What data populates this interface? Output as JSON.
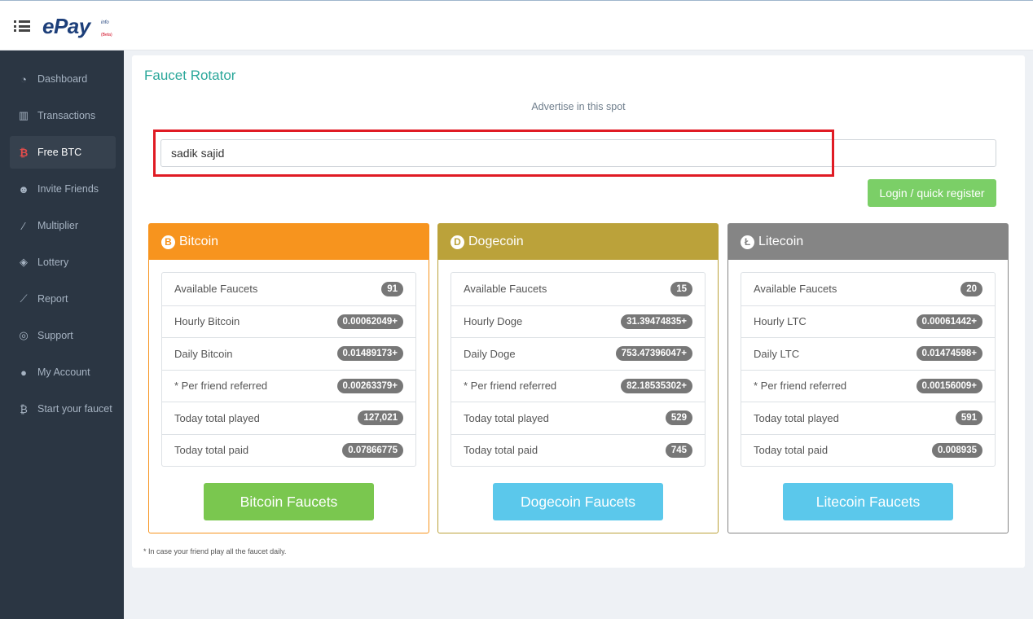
{
  "brand": {
    "logo": "ePay",
    "logo_sup": "info",
    "beta": "(Beta)"
  },
  "sidebar": {
    "items": [
      {
        "label": "Dashboard",
        "icon": "tachometer-icon"
      },
      {
        "label": "Transactions",
        "icon": "bar-chart-icon"
      },
      {
        "label": "Free BTC",
        "icon": "bitcoin-icon",
        "active": true
      },
      {
        "label": "Invite Friends",
        "icon": "users-icon"
      },
      {
        "label": "Multiplier",
        "icon": "magic-wand-icon"
      },
      {
        "label": "Lottery",
        "icon": "ticket-icon"
      },
      {
        "label": "Report",
        "icon": "line-chart-icon"
      },
      {
        "label": "Support",
        "icon": "life-ring-icon"
      },
      {
        "label": "My Account",
        "icon": "user-icon"
      },
      {
        "label": "Start your faucet",
        "icon": "bitcoin-icon"
      }
    ]
  },
  "main": {
    "title": "Faucet Rotator",
    "advertise": "Advertise in this spot",
    "address_value": "sadik sajid",
    "login_label": "Login / quick register",
    "note": "* In case your friend play all the faucet daily."
  },
  "coins": [
    {
      "name": "Bitcoin",
      "symbol": "B",
      "color": "#f7941e",
      "button_color": "#7ac74f",
      "button_label": "Bitcoin Faucets",
      "stats": [
        {
          "label": "Available Faucets",
          "value": "91"
        },
        {
          "label": "Hourly Bitcoin",
          "value": "0.00062049+"
        },
        {
          "label": "Daily Bitcoin",
          "value": "0.01489173+"
        },
        {
          "label": "* Per friend referred",
          "value": "0.00263379+"
        },
        {
          "label": "Today total played",
          "value": "127,021"
        },
        {
          "label": "Today total paid",
          "value": "0.07866775"
        }
      ]
    },
    {
      "name": "Dogecoin",
      "symbol": "D",
      "color": "#bba23a",
      "button_color": "#5bc8eb",
      "button_label": "Dogecoin Faucets",
      "stats": [
        {
          "label": "Available Faucets",
          "value": "15"
        },
        {
          "label": "Hourly Doge",
          "value": "31.39474835+"
        },
        {
          "label": "Daily Doge",
          "value": "753.47396047+"
        },
        {
          "label": "* Per friend referred",
          "value": "82.18535302+"
        },
        {
          "label": "Today total played",
          "value": "529"
        },
        {
          "label": "Today total paid",
          "value": "745"
        }
      ]
    },
    {
      "name": "Litecoin",
      "symbol": "Ł",
      "color": "#858585",
      "button_color": "#5bc8eb",
      "button_label": "Litecoin Faucets",
      "stats": [
        {
          "label": "Available Faucets",
          "value": "20"
        },
        {
          "label": "Hourly LTC",
          "value": "0.00061442+"
        },
        {
          "label": "Daily LTC",
          "value": "0.01474598+"
        },
        {
          "label": "* Per friend referred",
          "value": "0.00156009+"
        },
        {
          "label": "Today total played",
          "value": "591"
        },
        {
          "label": "Today total paid",
          "value": "0.008935"
        }
      ]
    }
  ]
}
